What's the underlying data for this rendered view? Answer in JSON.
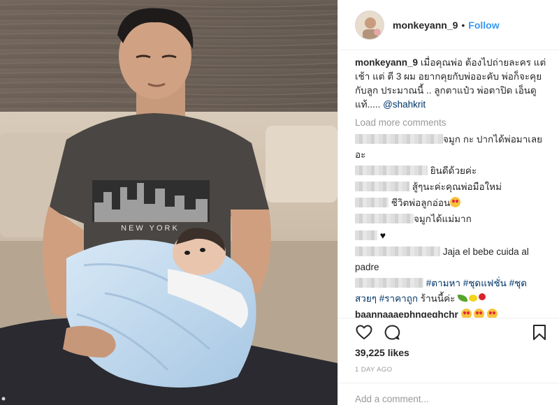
{
  "post": {
    "username": "monkeyann_9",
    "separator": "•",
    "follow_label": "Follow",
    "caption_user": "monkeyann_9",
    "caption_text": "เมื่อคุณพ่อ ต้องไปถ่ายละคร แต่เช้า แต่ ตี 3 ผม อยากคุยกับพ่ออะคับ พ่อก็จะคุยกับลูก ประมาณนี้ .. ลูกตาแป๋ว พ่อตาปิด เอ็นดูแท้..... ",
    "caption_mention": "@shahkrit",
    "load_more": "Load more comments",
    "comments": [
      {
        "text": "จมูก กะ ปากได้พ่อมาเลยอะ"
      },
      {
        "text": "ยินดีด้วยค่ะ"
      },
      {
        "text": "สู้ๆนะค่ะคุณพ่อมือใหม่"
      },
      {
        "text": "ชีวิตพ่อลูกอ่อน"
      },
      {
        "text": "จมูกได้แม่มาก"
      },
      {
        "text": ""
      },
      {
        "text": "Jaja el bebe cuida al padre"
      },
      {
        "tag1": "#ตามหา",
        "tag2": "#ชุดแฟชั่น",
        "tag3": "#ชุดสวยๆ",
        "tag4": "#ราคาถูก",
        "text": "ร้านนี้ค่ะ"
      },
      {
        "user": "baannaaaephngeghchr"
      }
    ],
    "likes": "39,225 likes",
    "time": "1 DAY AGO",
    "add_comment_placeholder": "Add a comment..."
  },
  "photo": {
    "shirt_text": "NEW YORK"
  },
  "icons": {
    "like": "heart-outline-icon",
    "comment": "comment-bubble-icon",
    "save": "bookmark-icon"
  },
  "colors": {
    "accent": "#3897f0",
    "text": "#262626",
    "muted": "#999999",
    "border": "#efefef",
    "mention": "#003569"
  }
}
